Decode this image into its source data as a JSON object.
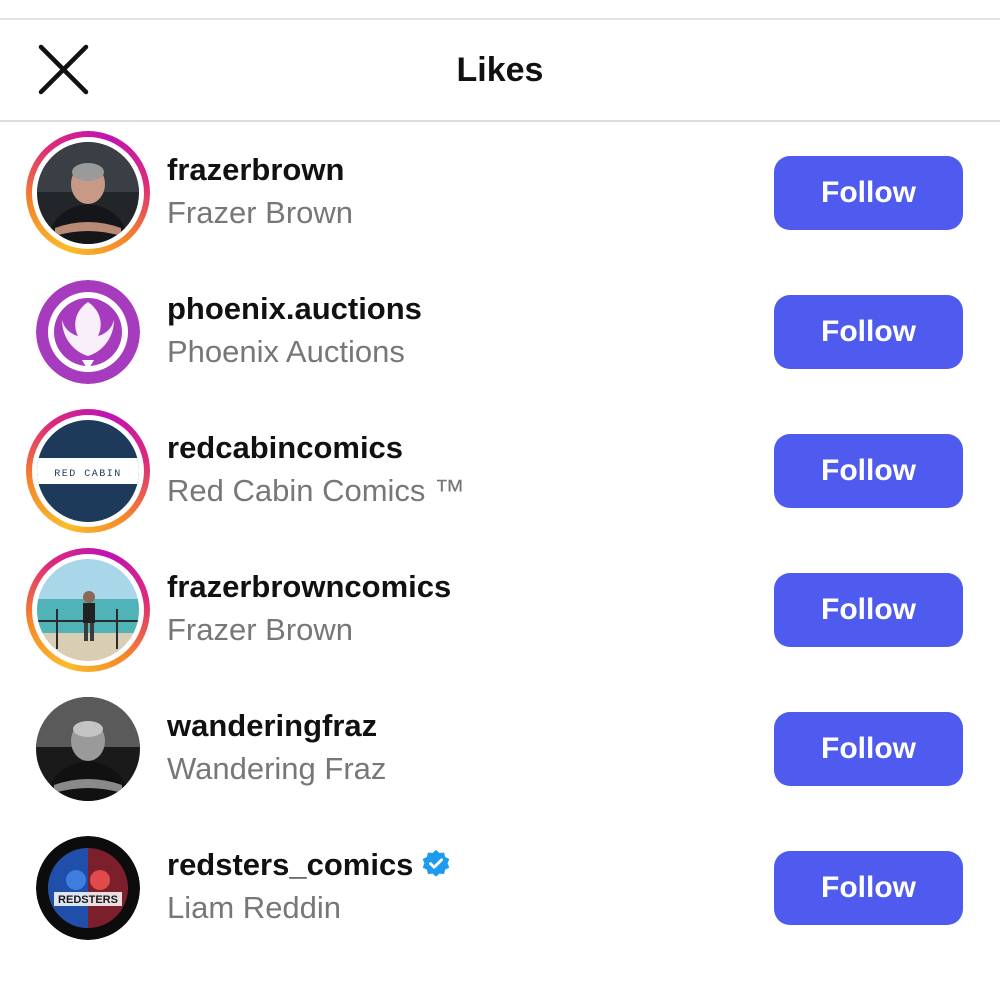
{
  "header": {
    "title": "Likes",
    "close_icon": "close-icon"
  },
  "users": [
    {
      "username": "frazerbrown",
      "full_name": "Frazer Brown",
      "follow_label": "Follow",
      "story_ring": true,
      "verified": false
    },
    {
      "username": "phoenix.auctions",
      "full_name": "Phoenix Auctions",
      "follow_label": "Follow",
      "story_ring": false,
      "verified": false
    },
    {
      "username": "redcabincomics",
      "full_name": "Red Cabin Comics ™",
      "follow_label": "Follow",
      "story_ring": true,
      "verified": false,
      "avatar_text": "RED CABIN"
    },
    {
      "username": "frazerbrowncomics",
      "full_name": "Frazer Brown",
      "follow_label": "Follow",
      "story_ring": true,
      "verified": false
    },
    {
      "username": "wanderingfraz",
      "full_name": "Wandering Fraz",
      "follow_label": "Follow",
      "story_ring": false,
      "verified": false
    },
    {
      "username": "redsters_comics",
      "full_name": "Liam Reddin",
      "follow_label": "Follow",
      "story_ring": false,
      "verified": true,
      "avatar_text": "REDSTERS"
    }
  ],
  "colors": {
    "follow_button": "#4f5bef",
    "verified_badge": "#1d9bf0",
    "phoenix_purple": "#a63bbd",
    "red_cabin_navy": "#1d3a5a"
  }
}
